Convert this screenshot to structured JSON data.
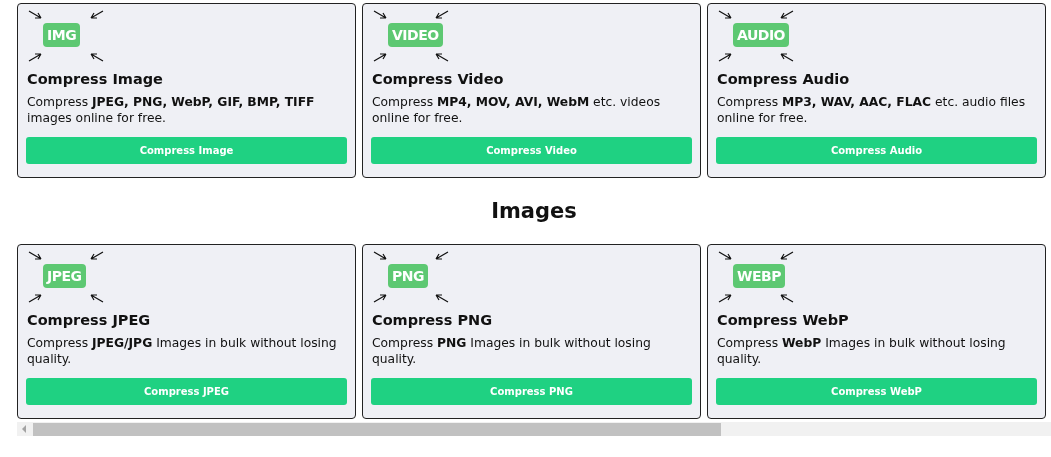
{
  "sections": [
    {
      "cards": [
        {
          "badge": "IMG",
          "title": "Compress Image",
          "description": "Compress **JPEG, PNG, WebP, GIF, BMP, TIFF** images online for free.",
          "button": "Compress Image"
        },
        {
          "badge": "VIDEO",
          "title": "Compress Video",
          "description": "Compress **MP4, MOV, AVI, WebM** etc. videos online for free.",
          "button": "Compress Video"
        },
        {
          "badge": "AUDIO",
          "title": "Compress Audio",
          "description": "Compress **MP3, WAV, AAC, FLAC** etc. audio files online for free.",
          "button": "Compress Audio"
        }
      ]
    },
    {
      "heading": "Images",
      "cards": [
        {
          "badge": "JPEG",
          "title": "Compress JPEG",
          "description": "Compress **JPEG/JPG** Images in bulk without losing quality.",
          "button": "Compress JPEG"
        },
        {
          "badge": "PNG",
          "title": "Compress PNG",
          "description": "Compress **PNG** Images in bulk without losing quality.",
          "button": "Compress PNG"
        },
        {
          "badge": "WEBP",
          "title": "Compress WebP",
          "description": "Compress **WebP** Images in bulk without losing quality.",
          "button": "Compress WebP"
        }
      ]
    }
  ]
}
